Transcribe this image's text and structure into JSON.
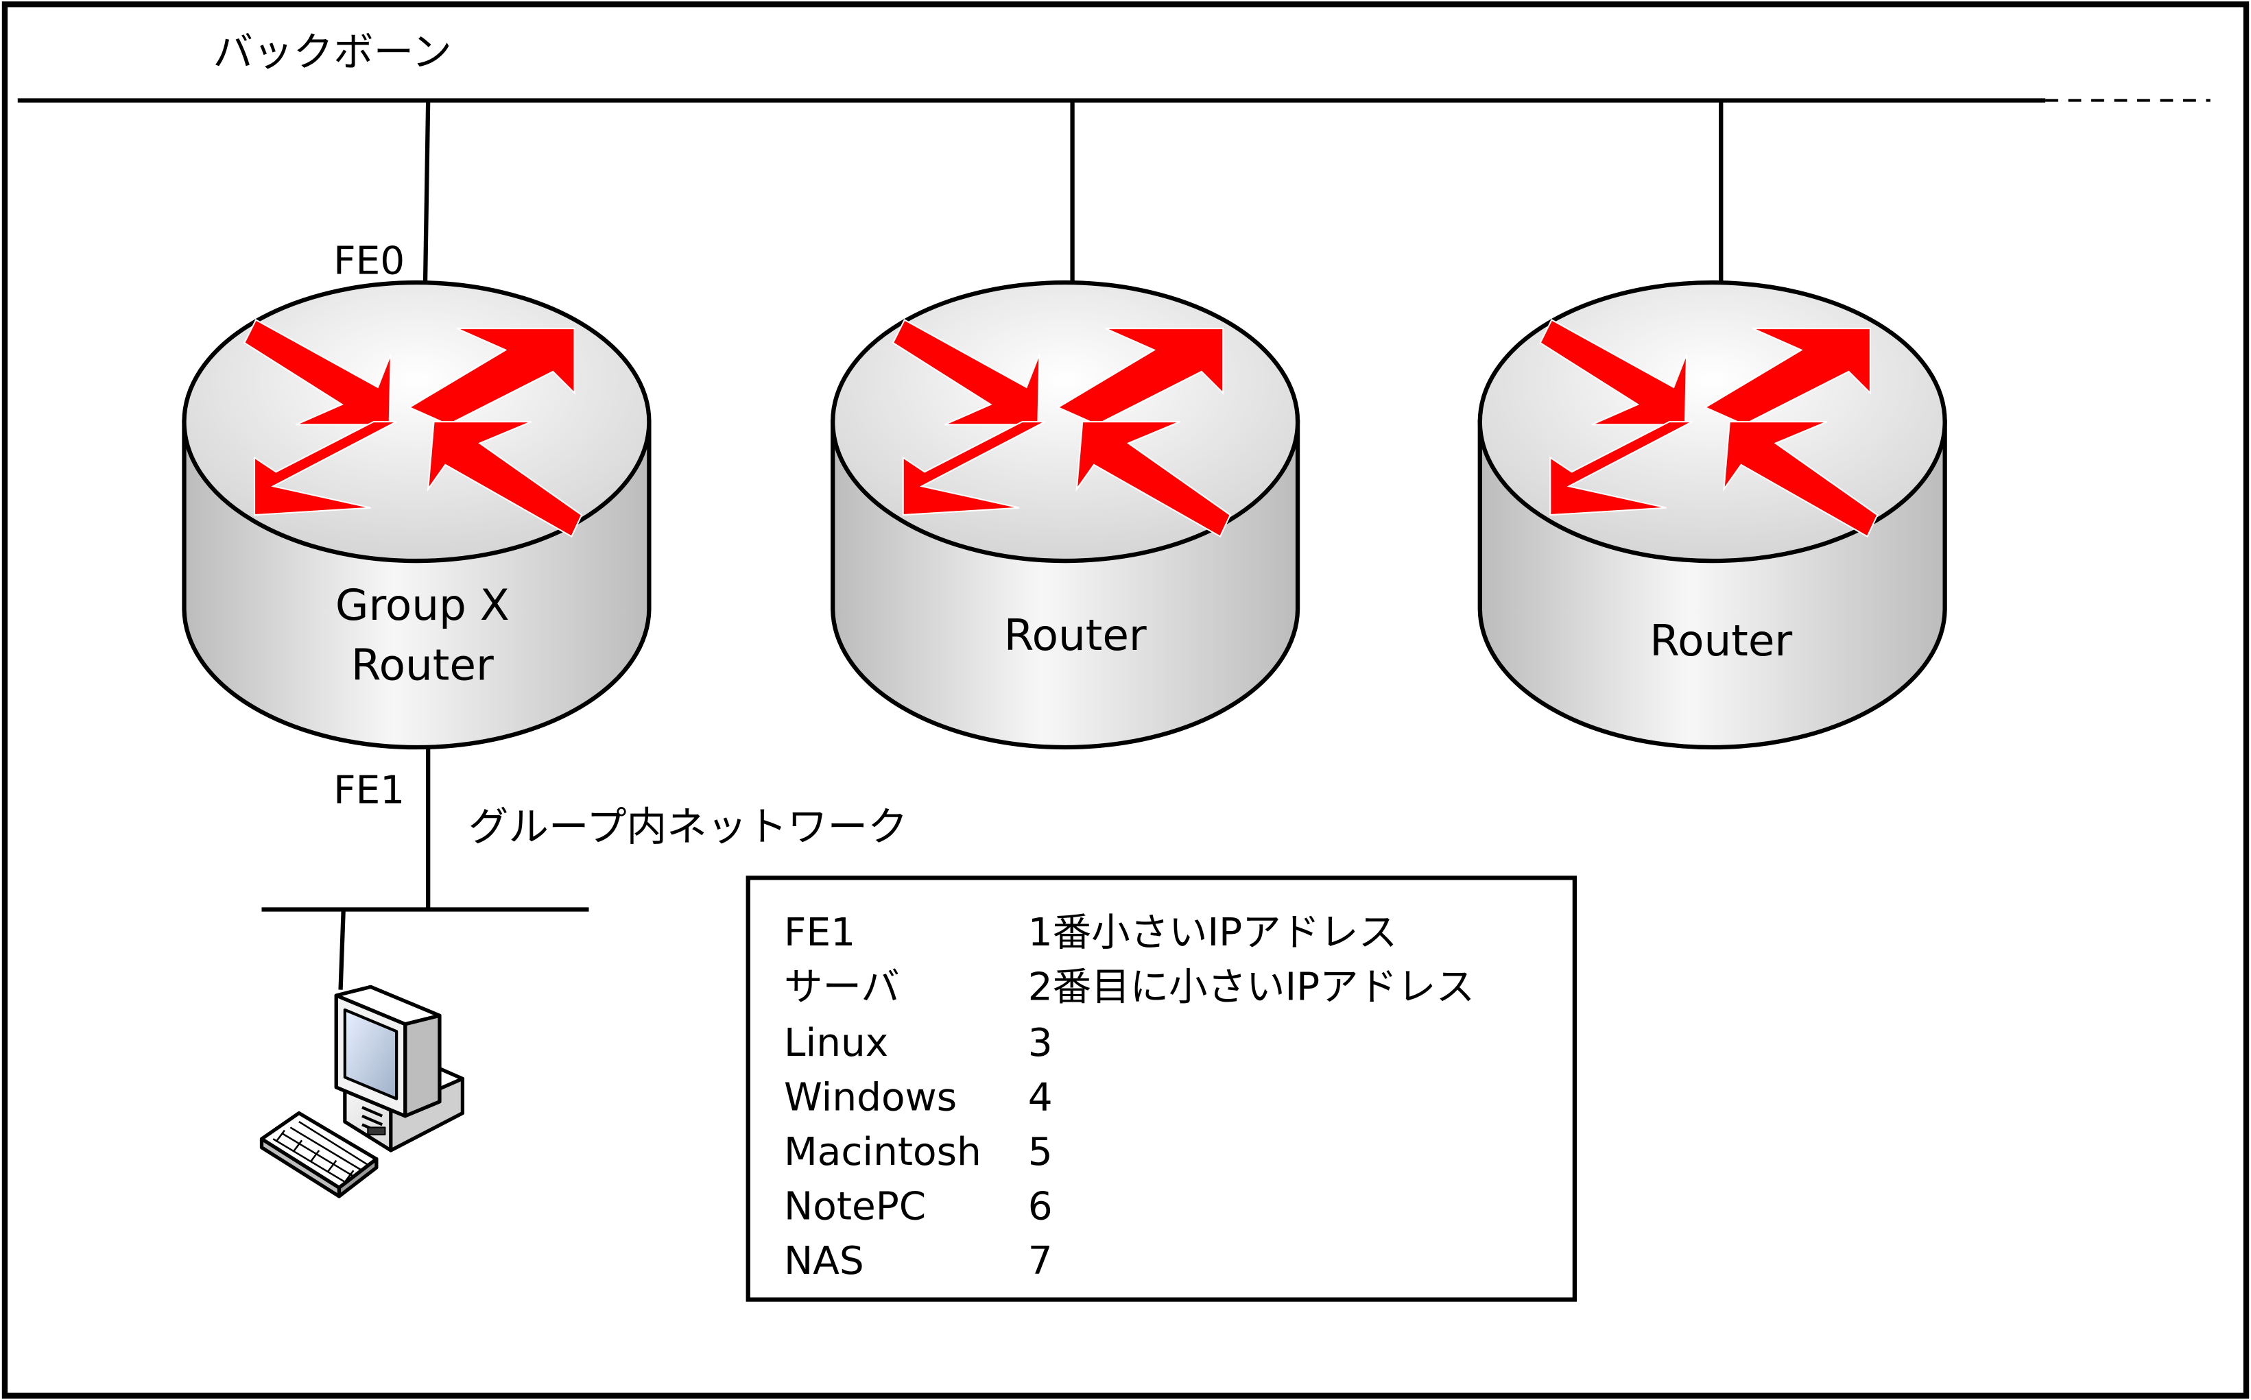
{
  "backbone": {
    "label": "バックボーン"
  },
  "routers": [
    {
      "port_top": "FE0",
      "label_lines": [
        "Group X",
        "Router"
      ],
      "port_bottom": "FE1"
    },
    {
      "label_lines": [
        "Router"
      ]
    },
    {
      "label_lines": [
        "Router"
      ]
    }
  ],
  "group_network": {
    "label": "グループ内ネットワーク"
  },
  "address_table": {
    "rows": [
      {
        "name": "FE1",
        "value": "1番小さいIPアドレス"
      },
      {
        "name": "サーバ",
        "value": "2番目に小さいIPアドレス"
      },
      {
        "name": "Linux",
        "value": "3"
      },
      {
        "name": "Windows",
        "value": "4"
      },
      {
        "name": "Macintosh",
        "value": "5"
      },
      {
        "name": "NotePC",
        "value": "6"
      },
      {
        "name": "NAS",
        "value": "7"
      }
    ]
  },
  "colors": {
    "arrow_red": "#ff0000",
    "line": "#000000",
    "router_light": "#f4f4f4",
    "router_dark": "#c4c4c4"
  },
  "icons": {
    "router": "router-icon",
    "workstation": "desktop-computer-icon"
  }
}
